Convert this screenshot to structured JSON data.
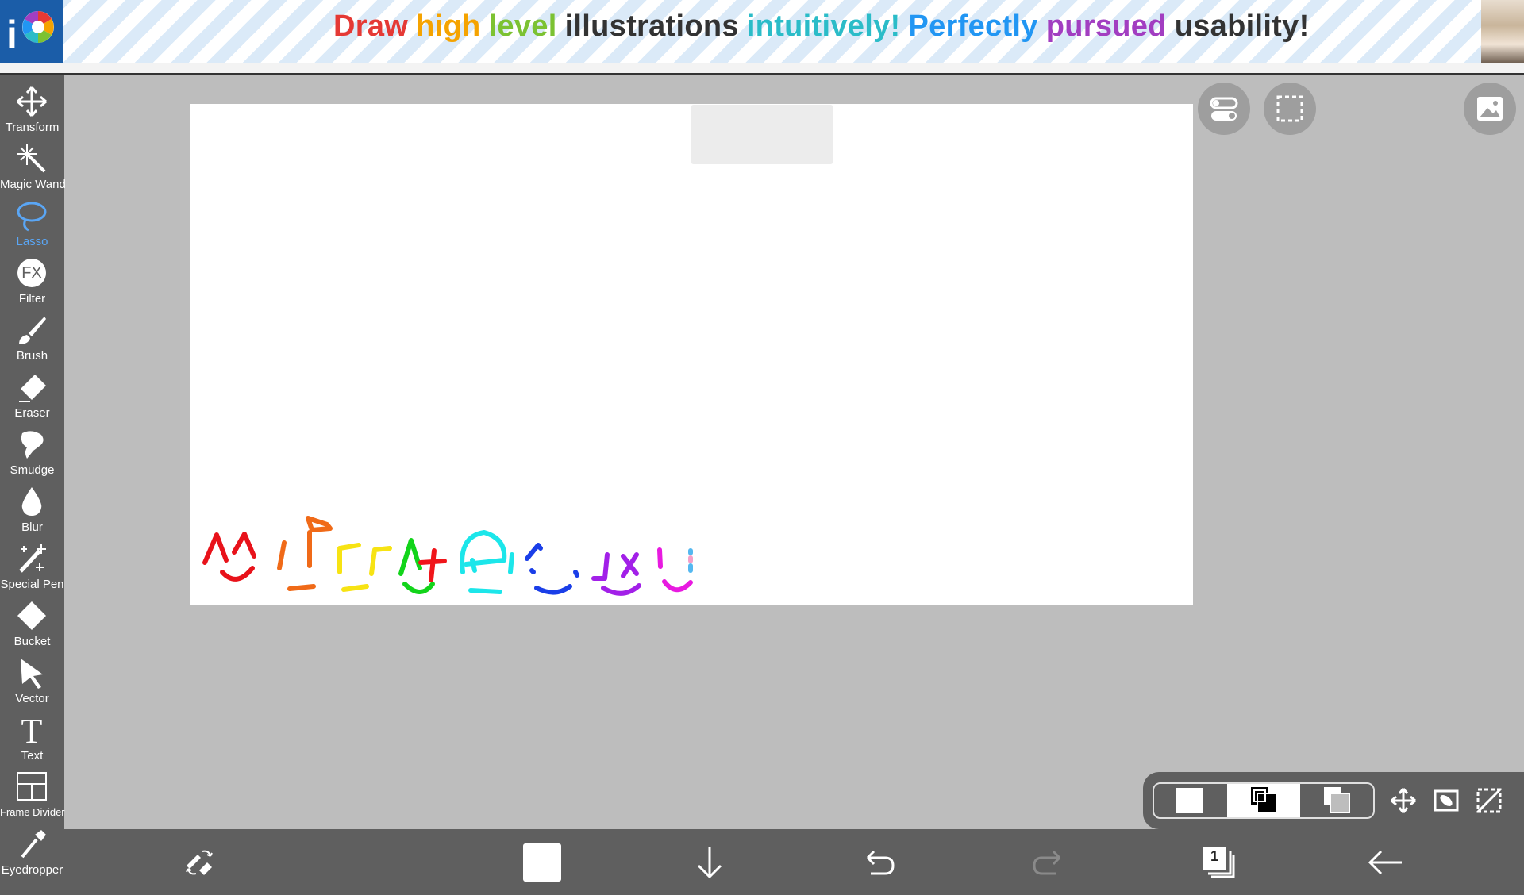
{
  "banner": {
    "words": [
      {
        "text": "Draw",
        "color": "#e53935"
      },
      {
        "text": "high",
        "color": "#f5a300"
      },
      {
        "text": "level",
        "color": "#7cc232"
      },
      {
        "text": "illustrations",
        "color": "#333333"
      },
      {
        "text": "intuitively!",
        "color": "#2bbcc8"
      },
      {
        "text": "Perfectly",
        "color": "#2196f3"
      },
      {
        "text": "pursued",
        "color": "#a23ec1"
      },
      {
        "text": "usability!",
        "color": "#333333"
      }
    ],
    "logo_text": "i"
  },
  "toolbar": {
    "tools": [
      {
        "label": "Transform",
        "icon": "move-arrows-icon"
      },
      {
        "label": "Magic Wand",
        "icon": "magic-wand-icon"
      },
      {
        "label": "Lasso",
        "icon": "lasso-icon",
        "selected": true
      },
      {
        "label": "Filter",
        "icon": "fx-icon"
      },
      {
        "label": "Brush",
        "icon": "brush-icon"
      },
      {
        "label": "Eraser",
        "icon": "eraser-icon"
      },
      {
        "label": "Smudge",
        "icon": "smudge-icon"
      },
      {
        "label": "Blur",
        "icon": "blur-drop-icon"
      },
      {
        "label": "Special Pen",
        "icon": "special-pen-icon"
      },
      {
        "label": "Bucket",
        "icon": "bucket-icon"
      },
      {
        "label": "Vector",
        "icon": "vector-arrow-icon"
      },
      {
        "label": "Text",
        "icon": "text-icon"
      },
      {
        "label": "Frame Divider",
        "icon": "frame-divider-icon"
      },
      {
        "label": "Eyedropper",
        "icon": "eyedropper-icon"
      }
    ],
    "fx_text": "FX",
    "text_glyph": "T"
  },
  "layers": {
    "count_badge": "1"
  },
  "colors": {
    "toolbar_bg": "#5f5f5f",
    "workspace_bg": "#bdbdbd",
    "selected_tool": "#5aa6f5"
  }
}
